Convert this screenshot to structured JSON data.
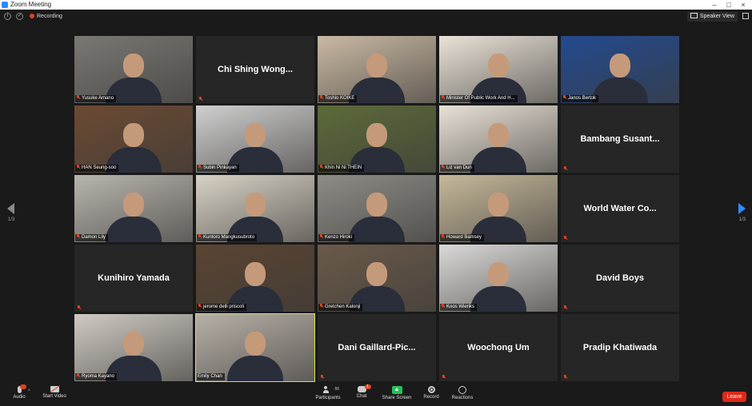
{
  "window": {
    "title": "Zoom Meeting"
  },
  "topbar": {
    "recording_label": "Recording",
    "view_label": "Speaker View"
  },
  "pagination": {
    "left_page": "1/3",
    "right_page": "1/3"
  },
  "colors": {
    "accent": "#2d8cff",
    "muted": "#e0431f",
    "active_speaker": "#d6e34a",
    "share": "#23c15a",
    "leave": "#e0281b"
  },
  "participants": [
    {
      "name": "Yusuke Amano",
      "video": true,
      "muted": true,
      "bg": "#7a7873"
    },
    {
      "name": "Chi Shing Wong...",
      "video": false,
      "muted": true
    },
    {
      "name": "Toshio KOIKE",
      "video": true,
      "muted": true,
      "bg": "#c9b9a3"
    },
    {
      "name": "Minister Of Public Work And H...",
      "video": true,
      "muted": true,
      "bg": "#e9e2d7"
    },
    {
      "name": "Janos Bertok",
      "video": true,
      "muted": true,
      "bg": "#234a8f"
    },
    {
      "name": "HAN Seung-soo",
      "video": true,
      "muted": true,
      "bg": "#6b4a33"
    },
    {
      "name": "Subin Pinkayan",
      "video": true,
      "muted": true,
      "bg": "#cfcfcf"
    },
    {
      "name": "Khin Ni Ni THEIN",
      "video": true,
      "muted": true,
      "bg": "#5c6b3a"
    },
    {
      "name": "Liz van Dun",
      "video": true,
      "muted": true,
      "bg": "#e8e1d6"
    },
    {
      "name": "Bambang Susant...",
      "video": false,
      "muted": true
    },
    {
      "name": "Damon Lily",
      "video": true,
      "muted": true,
      "bg": "#b8b5ae"
    },
    {
      "name": "Kuntoro Mangkusubroto",
      "video": true,
      "muted": true,
      "bg": "#d8d2c5"
    },
    {
      "name": "Kenzo Hiroki",
      "video": true,
      "muted": true,
      "bg": "#8e8c86"
    },
    {
      "name": "Howard Bamsey",
      "video": true,
      "muted": true,
      "bg": "#c5b89a"
    },
    {
      "name": "World Water Co...",
      "video": false,
      "muted": true
    },
    {
      "name": "Kunihiro Yamada",
      "video": false,
      "muted": true
    },
    {
      "name": "jerome delli priscoli",
      "video": true,
      "muted": true,
      "bg": "#5a4432"
    },
    {
      "name": "Gretchen Kalonji",
      "video": true,
      "muted": true,
      "bg": "#6a5a4a"
    },
    {
      "name": "Koos Wieriks",
      "video": true,
      "muted": true,
      "bg": "#d9d9d7"
    },
    {
      "name": "David Boys",
      "video": false,
      "muted": true
    },
    {
      "name": "Ryoma Kayano",
      "video": true,
      "muted": true,
      "bg": "#cfcac3"
    },
    {
      "name": "Emily Chan",
      "video": true,
      "muted": false,
      "active": true,
      "bg": "#b7b0a7"
    },
    {
      "name": "Dani Gaillard-Pic...",
      "video": false,
      "muted": true
    },
    {
      "name": "Woochong Um",
      "video": false,
      "muted": true
    },
    {
      "name": "Pradip Khatiwada",
      "video": false,
      "muted": true
    }
  ],
  "toolbar": {
    "audio_label": "Audio",
    "video_label": "Start Video",
    "participants_label": "Participants",
    "participants_count": "66",
    "chat_label": "Chat",
    "chat_badge": "1",
    "share_label": "Share Screen",
    "record_label": "Record",
    "reactions_label": "Reactions",
    "leave_label": "Leave"
  }
}
